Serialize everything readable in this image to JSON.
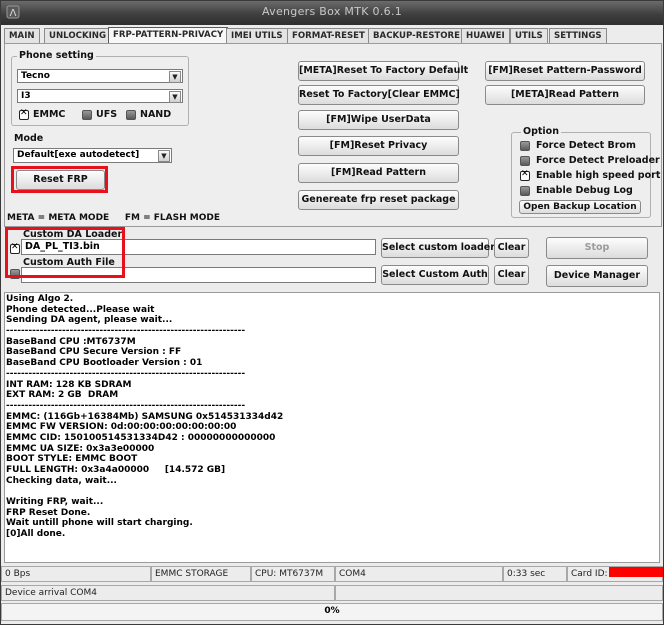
{
  "app": {
    "title": "Avengers Box MTK 0.6.1"
  },
  "tabs": [
    "MAIN",
    "UNLOCKING",
    "FRP-PATTERN-PRIVACY",
    "IMEI UTILS",
    "FORMAT-RESET",
    "BACKUP-RESTORE",
    "HUAWEI",
    "UTILS",
    "SETTINGS"
  ],
  "active_tab": "FRP-PATTERN-PRIVACY",
  "phone_setting": {
    "legend": "Phone setting",
    "brand": "Tecno",
    "model": "I3",
    "storage": [
      {
        "label": "EMMC",
        "checked": true
      },
      {
        "label": "UFS",
        "checked": false
      },
      {
        "label": "NAND",
        "checked": false
      }
    ]
  },
  "mode": {
    "label": "Mode",
    "value": "Default[exe autodetect]"
  },
  "reset_frp_label": "Reset FRP",
  "mode_legend_text": "META = META MODE     FM = FLASH MODE",
  "center_buttons": [
    "[META]Reset To Factory Default",
    "Reset To Factory[Clear EMMC]",
    "[FM]Wipe UserData",
    "[FM]Reset Privacy",
    "[FM]Read Pattern",
    "Genereate frp reset package"
  ],
  "right_buttons": [
    "[FM]Reset Pattern-Password",
    "[META]Read Pattern"
  ],
  "option": {
    "legend": "Option",
    "items": [
      {
        "label": "Force Detect Brom",
        "checked": false
      },
      {
        "label": "Force Detect Preloader",
        "checked": false
      },
      {
        "label": "Enable high speed port",
        "checked": true
      },
      {
        "label": "Enable Debug Log",
        "checked": false
      }
    ],
    "open_backup_label": "Open Backup Location"
  },
  "loader": {
    "da_label": "Custom DA Loader",
    "da_value": "DA_PL_TI3.bin",
    "da_checked": true,
    "auth_label": "Custom Auth File",
    "auth_value": "",
    "auth_checked": false,
    "select_loader_label": "Select custom loader",
    "select_auth_label": "Select Custom Auth",
    "clear_label": "Clear",
    "stop_label": "Stop",
    "device_manager_label": "Device Manager"
  },
  "log_lines": [
    "Using Algo 2.",
    "Phone detected...Please wait",
    "Sending DA agent, please wait...",
    "----------------------------------------------------------------",
    "BaseBand CPU :MT6737M",
    "BaseBand CPU Secure Version : FF",
    "BaseBand CPU Bootloader Version : 01",
    "----------------------------------------------------------------",
    "INT RAM: 128 KB SDRAM",
    "EXT RAM: 2 GB  DRAM",
    "----------------------------------------------------------------",
    "EMMC: (116Gb+16384Mb) SAMSUNG 0x514531334d42",
    "EMMC FW VERSION: 0d:00:00:00:00:00:00:00",
    "EMMC CID: 150100514531334D42 : 00000000000000",
    "EMMC UA SIZE: 0x3a3e00000",
    "BOOT STYLE: EMMC BOOT",
    "FULL LENGTH: 0x3a4a00000     [14.572 GB]",
    "Checking data, wait...",
    "",
    "Writing FRP, wait...",
    "FRP Reset Done.",
    "Wait untill phone will start charging.",
    "[0]All done."
  ],
  "status": {
    "speed": "0 Bps",
    "storage": "EMMC STORAGE",
    "cpu": "CPU: MT6737M",
    "port": "COM4",
    "time": "0:33 sec",
    "card_id_label": "Card ID:",
    "device_arrival": "Device arrival COM4",
    "progress": "0%",
    "progress_fraction": 0
  },
  "colors": {
    "highlight_box": "#e8111b",
    "redacted": "#ff0000"
  }
}
